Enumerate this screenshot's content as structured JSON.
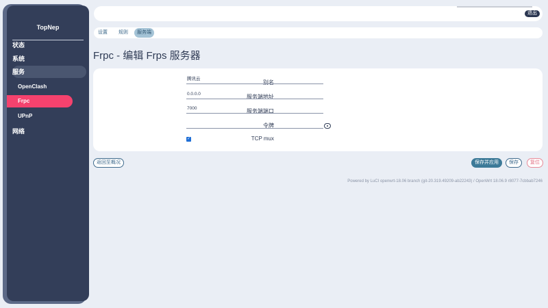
{
  "sidebar": {
    "brand": "TopNep",
    "items": [
      {
        "label": "状态"
      },
      {
        "label": "系统"
      },
      {
        "label": "服务"
      },
      {
        "label": "OpenClash"
      },
      {
        "label": "Frpc"
      },
      {
        "label": "UPnP"
      },
      {
        "label": "网络"
      }
    ]
  },
  "header": {
    "logout_label": "退出"
  },
  "tabs": [
    {
      "label": "设置"
    },
    {
      "label": "规则"
    },
    {
      "label": "服务端"
    }
  ],
  "page": {
    "title": "Frpc - 编辑 Frps 服务器"
  },
  "form": {
    "alias": {
      "label": "别名",
      "value": "腾讯云"
    },
    "server_addr": {
      "label": "服务端地址",
      "value": "0.0.0.0"
    },
    "server_port": {
      "label": "服务端端口",
      "value": "7000"
    },
    "token": {
      "label": "令牌",
      "value": ""
    },
    "tcp_mux": {
      "label": "TCP mux",
      "checked": true
    }
  },
  "actions": {
    "back": "返回至概况",
    "save_apply": "保存并应用",
    "save": "保存",
    "reset": "复位"
  },
  "footer": {
    "text": "Powered by LuCI openwrt-18.06 branch (git-20.319.49209-ab22243) / OpenWrt 18.06.9 r8077-7cbbab7246"
  },
  "colors": {
    "sidebar": "#333e59",
    "selected": "#f5426e",
    "accent": "#3d7a98"
  }
}
